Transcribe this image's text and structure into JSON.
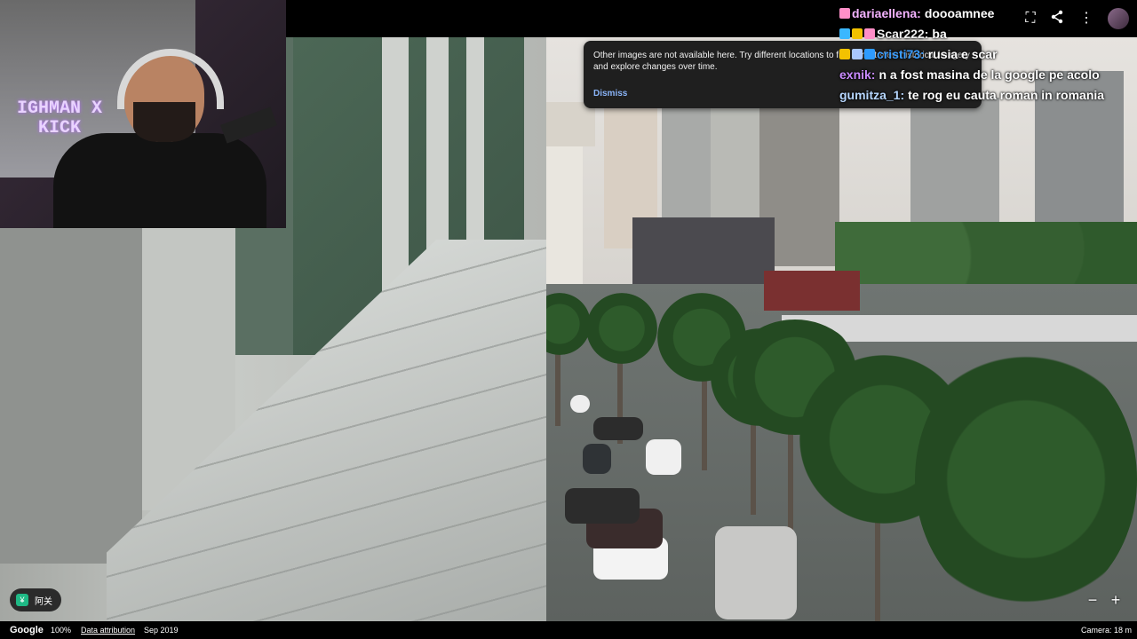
{
  "notice": {
    "message": "Other images are not available here. Try different locations to find Street View historical imagery and explore changes over time.",
    "dismiss_label": "Dismiss"
  },
  "chat": [
    {
      "user": "dariaellena:",
      "text": "doooamnee",
      "color": "#f4b3ff"
    },
    {
      "user": "Scar222:",
      "text": "ba",
      "color": "#f0f0f0"
    },
    {
      "user": "cristi73:",
      "text": "rusia e scar",
      "color": "#3b9dff"
    },
    {
      "user": "exnik:",
      "text": "n a fost masina de la google pe acolo",
      "color": "#c98bff"
    },
    {
      "user": "gumitza_1:",
      "text": "te rog eu cauta roman in romania",
      "color": "#b7d7ff"
    }
  ],
  "webcam": {
    "banner_text": "IGHMAN X KICK"
  },
  "location_chip": {
    "icon": "¥",
    "label": "阿关"
  },
  "zoom": {
    "minus": "−",
    "plus": "+"
  },
  "bottom_bar": {
    "logo": "Google",
    "zoom_level": "100%",
    "data_attribution": "Data attribution",
    "date": "Sep 2019",
    "camera": "Camera: 18 m"
  },
  "top_icons": [
    "fullscreen-icon",
    "share-icon",
    "more-vert-icon",
    "avatar"
  ]
}
